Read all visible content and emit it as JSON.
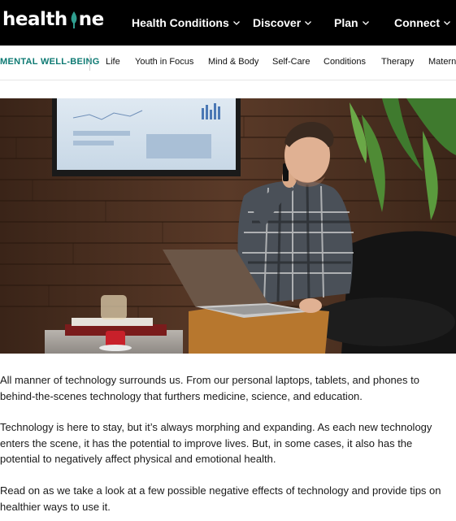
{
  "header": {
    "logo_text_left": "health",
    "logo_text_right": "ne",
    "nav": [
      {
        "label": "Health Conditions"
      },
      {
        "label": "Discover"
      },
      {
        "label": "Plan"
      },
      {
        "label": "Connect"
      }
    ]
  },
  "subnav": {
    "category": "MENTAL WELL-BEING",
    "items": [
      "Life",
      "Youth in Focus",
      "Mind & Body",
      "Self-Care",
      "Conditions",
      "Therapy",
      "Matern"
    ]
  },
  "hero": {
    "icon": "photo-man-on-phone-with-laptop"
  },
  "article": {
    "paragraphs": [
      "All manner of technology surrounds us. From our personal laptops, tablets, and phones to behind-the-scenes technology that furthers medicine, science, and education.",
      "Technology is here to stay, but it’s always morphing and expanding. As each new technology enters the scene, it has the potential to improve lives. But, in some cases, it also has the potential to negatively affect physical and emotional health.",
      "Read on as we take a look at a few possible negative effects of technology and provide tips on healthier ways to use it."
    ]
  },
  "colors": {
    "header_bg": "#000000",
    "accent": "#0e7a73",
    "logo_leaf": "#2f9e8f"
  }
}
